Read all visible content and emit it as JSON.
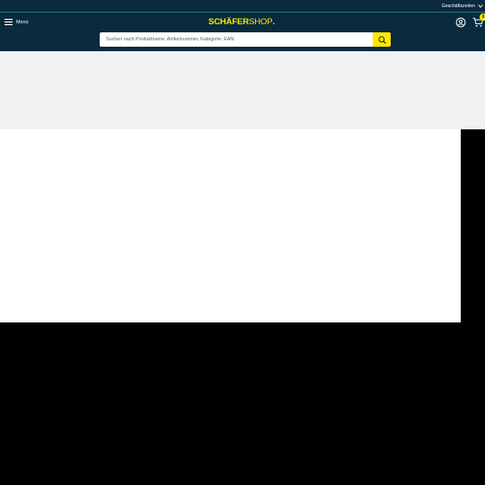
{
  "header": {
    "topbar": {
      "hours_label": "Geschäftszeiten"
    },
    "menu_label": "Menü",
    "logo": {
      "main": "SCHÄFER",
      "sub": "SHOP",
      "dot": "."
    },
    "search": {
      "placeholder": "Suchen nach Produktname, Artikelnummer, Kategorie, EAN",
      "value": ""
    },
    "cart_count": "0"
  },
  "colors": {
    "header_bg": "#0a2a3d",
    "accent": "#ffe600",
    "content_band": "#f0f1f3",
    "panel": "#ffffff",
    "backdrop": "#000000"
  },
  "icons": {
    "menu": "hamburger-icon",
    "hours": "chevron-down-icon",
    "account": "user-icon",
    "cart": "cart-icon",
    "search": "search-icon"
  }
}
